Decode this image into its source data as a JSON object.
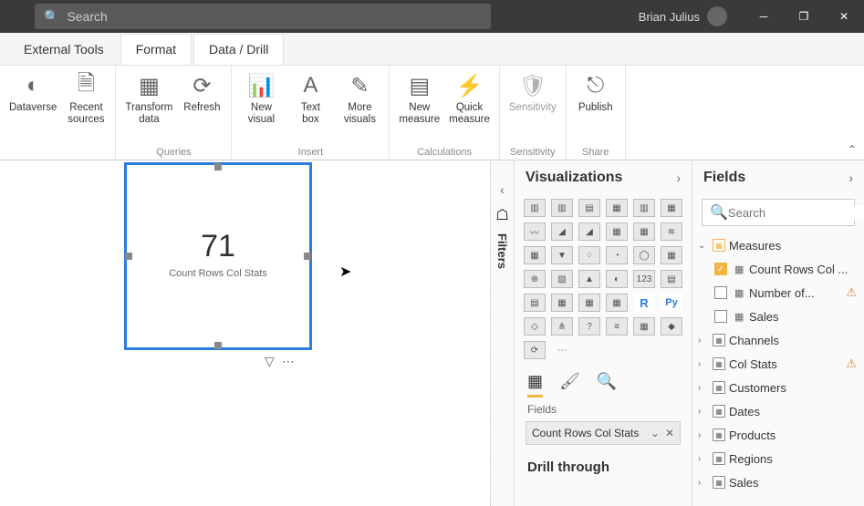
{
  "titlebar": {
    "search_placeholder": "Search",
    "user": "Brian Julius"
  },
  "tabs": {
    "external_tools": "External Tools",
    "format": "Format",
    "data_drill": "Data / Drill"
  },
  "ribbon": {
    "dataverse": "Dataverse",
    "recent_sources": "Recent\nsources",
    "transform_data": "Transform\ndata",
    "refresh": "Refresh",
    "new_visual": "New\nvisual",
    "text_box": "Text\nbox",
    "more_visuals": "More\nvisuals",
    "new_measure": "New\nmeasure",
    "quick_measure": "Quick\nmeasure",
    "sensitivity": "Sensitivity",
    "publish": "Publish",
    "group_queries": "Queries",
    "group_insert": "Insert",
    "group_calculations": "Calculations",
    "group_sensitivity": "Sensitivity",
    "group_share": "Share"
  },
  "card": {
    "value": "71",
    "label": "Count Rows Col Stats"
  },
  "viz_pane": {
    "title": "Visualizations",
    "fields_tab": "Fields",
    "well_value": "Count Rows Col Stats",
    "drill_title": "Drill through"
  },
  "fields_pane": {
    "title": "Fields",
    "search_placeholder": "Search",
    "measures_table": "Measures",
    "measures": {
      "m1": "Count Rows Col ...",
      "m2": "Number of...",
      "m3": "Sales"
    },
    "tables": {
      "channels": "Channels",
      "col_stats": "Col Stats",
      "customers": "Customers",
      "dates": "Dates",
      "products": "Products",
      "regions": "Regions",
      "sales": "Sales"
    }
  }
}
